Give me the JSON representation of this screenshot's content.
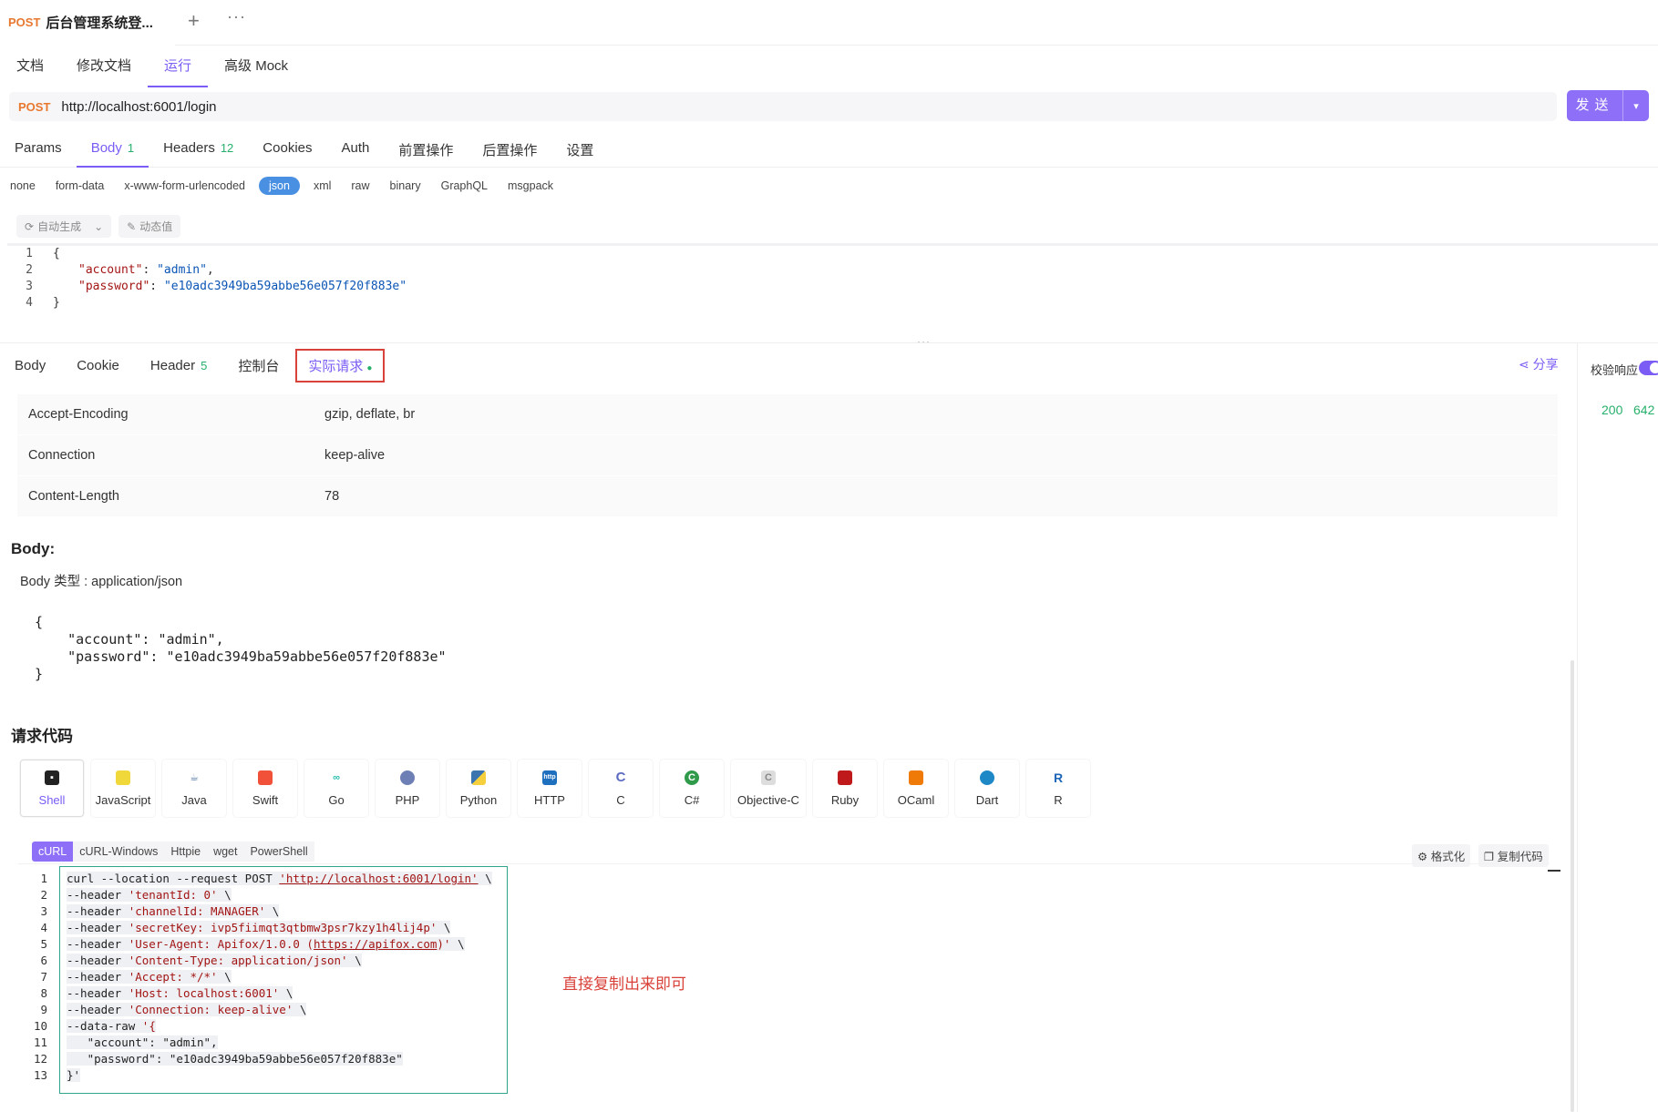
{
  "tab": {
    "method": "POST",
    "title": "后台管理系统登..."
  },
  "subtabs": [
    "文档",
    "修改文档",
    "运行",
    "高级 Mock"
  ],
  "request": {
    "method": "POST",
    "url": "http://localhost:6001/login",
    "send_label": "发送"
  },
  "req_tabs": [
    {
      "label": "Params",
      "count": ""
    },
    {
      "label": "Body",
      "count": "1"
    },
    {
      "label": "Headers",
      "count": "12"
    },
    {
      "label": "Cookies",
      "count": ""
    },
    {
      "label": "Auth",
      "count": ""
    },
    {
      "label": "前置操作",
      "count": ""
    },
    {
      "label": "后置操作",
      "count": ""
    },
    {
      "label": "设置",
      "count": ""
    }
  ],
  "body_types": [
    "none",
    "form-data",
    "x-www-form-urlencoded",
    "json",
    "xml",
    "raw",
    "binary",
    "GraphQL",
    "msgpack"
  ],
  "gen_buttons": {
    "auto": "自动生成",
    "dynamic": "动态值"
  },
  "editor": {
    "lines": [
      "1",
      "2",
      "3",
      "4"
    ],
    "l1": "{",
    "l2_key": "\"account\"",
    "l2_val": "\"admin\"",
    "l3_key": "\"password\"",
    "l3_val": "\"e10adc3949ba59abbe56e057f20f883e\"",
    "l4": "}"
  },
  "resp_tabs": [
    {
      "label": "Body",
      "count": ""
    },
    {
      "label": "Cookie",
      "count": ""
    },
    {
      "label": "Header",
      "count": "5"
    },
    {
      "label": "控制台",
      "count": ""
    },
    {
      "label": "实际请求",
      "count": ""
    }
  ],
  "share": "分享",
  "right_panel": {
    "verify": "校验响应",
    "status": "200",
    "time": "642"
  },
  "headers_table": [
    {
      "key": "Accept-Encoding",
      "value": "gzip, deflate, br"
    },
    {
      "key": "Connection",
      "value": "keep-alive"
    },
    {
      "key": "Content-Length",
      "value": "78"
    }
  ],
  "body_section": {
    "title": "Body:",
    "type": "Body 类型 : application/json",
    "json": "{\n    \"account\": \"admin\",\n    \"password\": \"e10adc3949ba59abbe56e057f20f883e\"\n}"
  },
  "code_section": {
    "title": "请求代码",
    "languages": [
      "Shell",
      "JavaScript",
      "Java",
      "Swift",
      "Go",
      "PHP",
      "Python",
      "HTTP",
      "C",
      "C#",
      "Objective-C",
      "Ruby",
      "OCaml",
      "Dart",
      "R"
    ],
    "variants": [
      "cURL",
      "cURL-Windows",
      "Httpie",
      "wget",
      "PowerShell"
    ],
    "format_label": "格式化",
    "copy_label": "复制代码",
    "note": "直接复制出来即可",
    "line_numbers": [
      "1",
      "2",
      "3",
      "4",
      "5",
      "6",
      "7",
      "8",
      "9",
      "10",
      "11",
      "12",
      "13"
    ],
    "curl": {
      "l1a": "curl --location --request POST ",
      "l1b": "'http://localhost:6001/login'",
      "l1c": " \\",
      "l2a": "--header ",
      "l2b": "'tenantId: 0'",
      "l2c": " \\",
      "l3a": "--header ",
      "l3b": "'channelId: MANAGER'",
      "l3c": " \\",
      "l4a": "--header ",
      "l4b": "'secretKey: ivp5fiimqt3qtbmw3psr7kzy1h4lij4p'",
      "l4c": " \\",
      "l5a": "--header ",
      "l5b": "'User-Agent: Apifox/1.0.0 (",
      "l5link": "https://apifox.com",
      "l5d": ")'",
      "l5c": " \\",
      "l6a": "--header ",
      "l6b": "'Content-Type: application/json'",
      "l6c": " \\",
      "l7a": "--header ",
      "l7b": "'Accept: */*'",
      "l7c": " \\",
      "l8a": "--header ",
      "l8b": "'Host: localhost:6001'",
      "l8c": " \\",
      "l9a": "--header ",
      "l9b": "'Connection: keep-alive'",
      "l9c": " \\",
      "l10a": "--data-raw ",
      "l10b": "'{",
      "l11": "   \"account\": \"admin\",",
      "l12": "   \"password\": \"e10adc3949ba59abbe56e057f20f883e\"",
      "l13": "}'"
    }
  },
  "colors": {
    "accent": "#7b5cf5",
    "method": "#e8782f",
    "success": "#26b06a",
    "highlight_box": "#d9423a"
  }
}
